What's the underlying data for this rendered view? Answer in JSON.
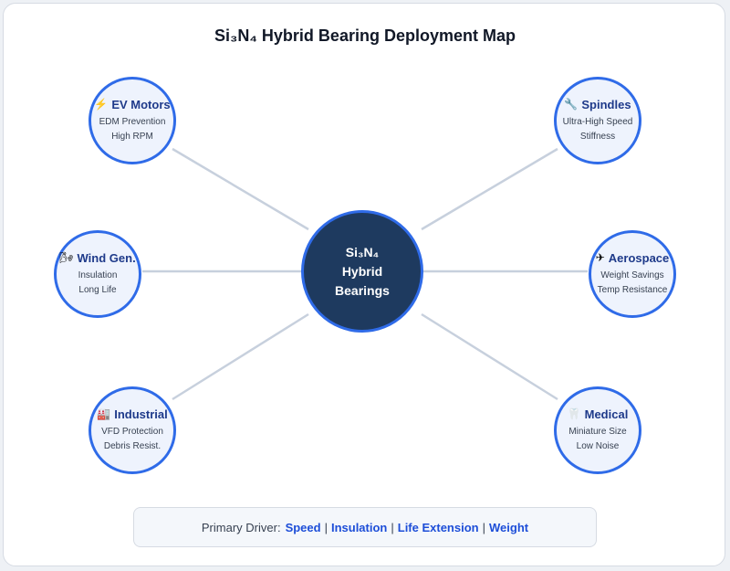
{
  "title": "Si₃N₄ Hybrid Bearing Deployment Map",
  "center": {
    "lines": [
      "Si₃N₄",
      "Hybrid",
      "Bearings"
    ]
  },
  "applications": [
    {
      "id": "ev-motors",
      "icon": "⚡",
      "icon_name": "lightning-icon",
      "label": "EV Motors",
      "details": [
        "EDM Prevention",
        "High RPM"
      ]
    },
    {
      "id": "spindles",
      "icon": "🔧",
      "icon_name": "wrench-icon",
      "label": "Spindles",
      "details": [
        "Ultra-High Speed",
        "Stiffness"
      ]
    },
    {
      "id": "wind-gen",
      "icon": "🌬",
      "icon_name": "wind-icon",
      "label": "Wind Gen.",
      "details": [
        "Insulation",
        "Long Life"
      ]
    },
    {
      "id": "aerospace",
      "icon": "✈",
      "icon_name": "airplane-icon",
      "label": "Aerospace",
      "details": [
        "Weight Savings",
        "Temp Resistance"
      ]
    },
    {
      "id": "industrial",
      "icon": "🏭",
      "icon_name": "factory-icon",
      "label": "Industrial",
      "details": [
        "VFD Protection",
        "Debris Resist."
      ]
    },
    {
      "id": "medical",
      "icon": "🦷",
      "icon_name": "tooth-icon",
      "label": "Medical",
      "details": [
        "Miniature Size",
        "Low Noise"
      ]
    }
  ],
  "legend": {
    "prefix": "Primary Driver:",
    "drivers": [
      "Speed",
      "Insulation",
      "Life Extension",
      "Weight"
    ],
    "separator": "|"
  },
  "colors": {
    "center_fill": "#1e3a5f",
    "node_border": "#2f6be8",
    "node_fill": "#eef3fd",
    "label": "#1e3a8a",
    "connector": "#c7d0dd",
    "keyword": "#1d4ed8"
  }
}
